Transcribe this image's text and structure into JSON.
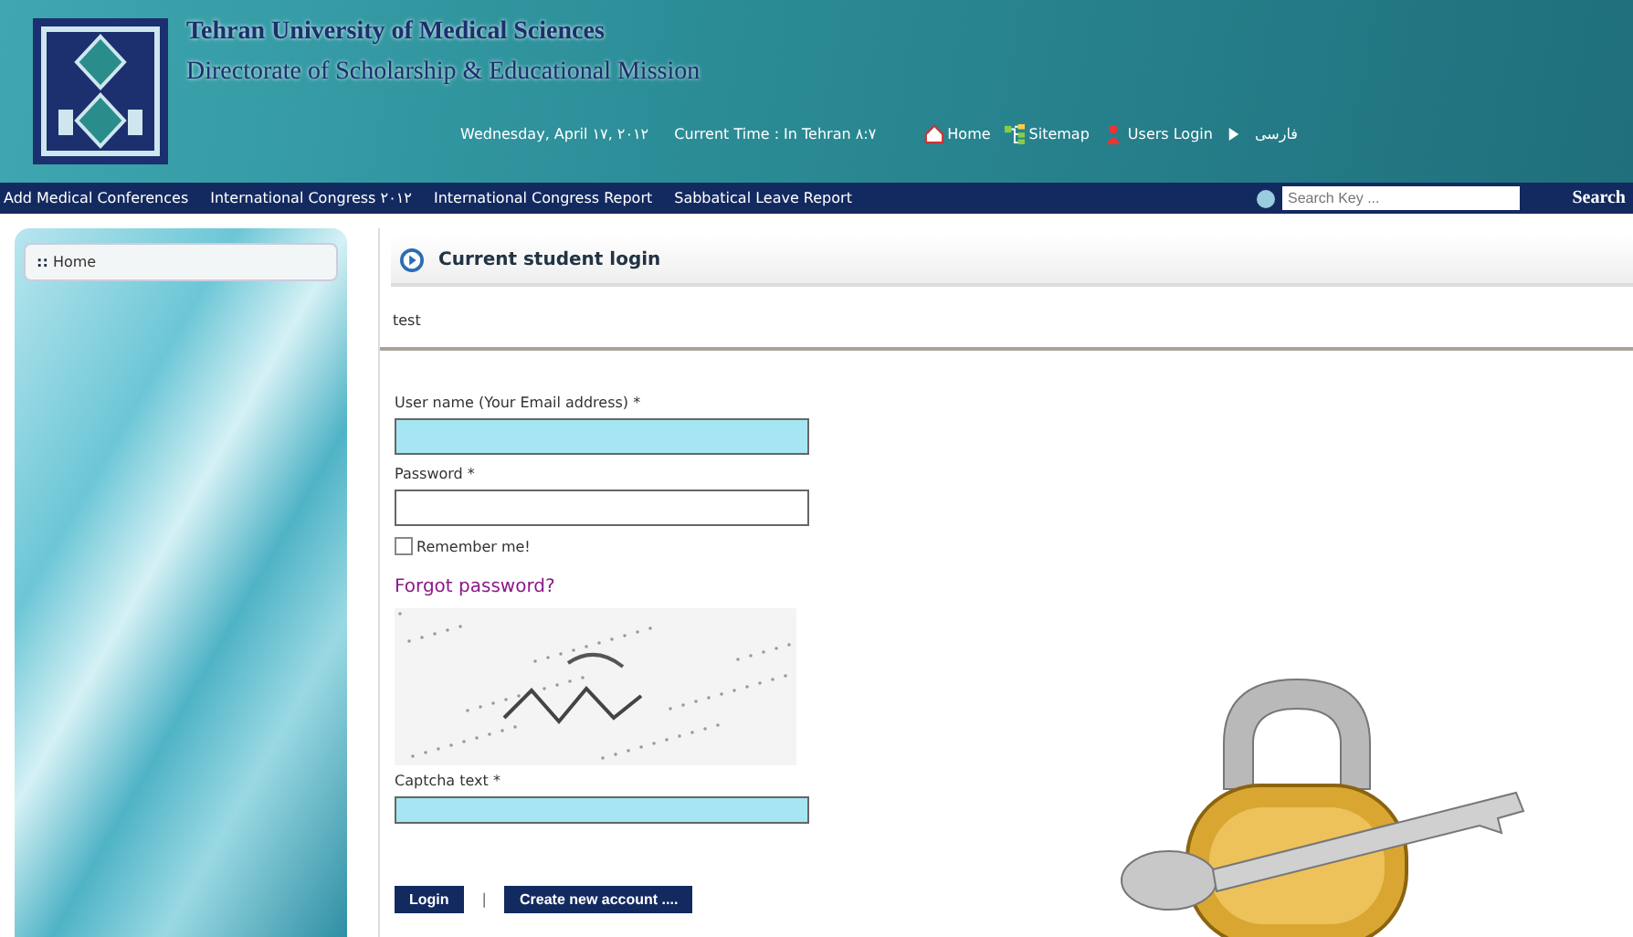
{
  "header": {
    "title": "Tehran University of Medical Sciences",
    "subtitle": "Directorate of Scholarship & Educational Mission",
    "date": "Wednesday, April ١٧, ٢٠١٢",
    "time": "Current Time : In Tehran ٨:٧",
    "links": [
      {
        "label": "Home",
        "kind": "home"
      },
      {
        "label": "Sitemap",
        "kind": "sitemap"
      },
      {
        "label": "Users Login",
        "kind": "user"
      },
      {
        "label": "فارسی",
        "kind": "arrow"
      }
    ]
  },
  "nav": {
    "items": [
      "Add Medical Conferences",
      "International Congress ٢٠١٢",
      "International Congress Report",
      "Sabbatical Leave Report"
    ],
    "search": {
      "placeholder": "Search Key ...",
      "button": "Search"
    }
  },
  "sidebar": {
    "items": [
      {
        "label": "Home",
        "marker": "::"
      }
    ]
  },
  "main": {
    "heading": "Current student login",
    "note": "test",
    "fields": [
      {
        "label": "User name (Your Email address) *",
        "highlighted": true
      },
      {
        "label": "Password *",
        "highlighted": false
      }
    ],
    "remember": {
      "label": "Remember me!",
      "checked": false
    },
    "forgot": "Forgot password?",
    "captcha": {
      "kind": "picture",
      "label": "Captcha text *",
      "highlighted": true
    },
    "buttons": [
      "Login",
      "Create new account ...."
    ],
    "separator": "|"
  }
}
